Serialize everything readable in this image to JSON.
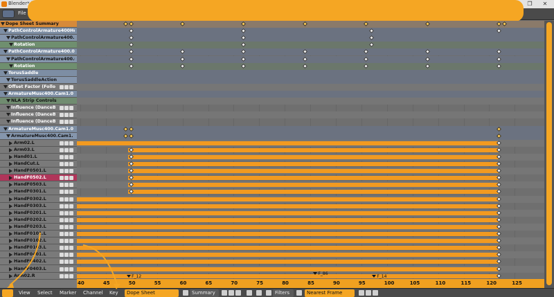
{
  "window": {
    "title": "Blender* [",
    "file_menu": "File"
  },
  "channels": [
    {
      "label": "Dope Sheet Summary",
      "kind": "summary",
      "indent": 0
    },
    {
      "label": "PathControlArmature400He",
      "kind": "object",
      "indent": 4
    },
    {
      "label": "PathControlArmature400.",
      "kind": "object2",
      "indent": 8
    },
    {
      "label": "Rotation",
      "kind": "group",
      "indent": 12
    },
    {
      "label": "PathControlArmature400.0",
      "kind": "object",
      "indent": 4
    },
    {
      "label": "PathControlArmature400.0",
      "kind": "object2",
      "indent": 8
    },
    {
      "label": "Rotation",
      "kind": "group",
      "indent": 12
    },
    {
      "label": "TorusSaddle",
      "kind": "object",
      "indent": 4
    },
    {
      "label": "TorusSaddleAction",
      "kind": "object2",
      "indent": 8
    },
    {
      "label": "Offset Factor (Follow Pat",
      "kind": "fcurve",
      "indent": 4
    },
    {
      "label": "ArmatureMusc400.Cam1.0",
      "kind": "object",
      "indent": 4
    },
    {
      "label": "NLA Strip Controls",
      "kind": "nla",
      "indent": 8
    },
    {
      "label": "Influence (DanceB33",
      "kind": "fcurve",
      "indent": 8
    },
    {
      "label": "Influence (DanceB33",
      "kind": "fcurve",
      "indent": 8
    },
    {
      "label": "Influence (DanceB33",
      "kind": "fcurve",
      "indent": 8
    },
    {
      "label": "ArmatureMusc400.Cam1.0",
      "kind": "object",
      "indent": 4
    },
    {
      "label": "ArmatureMusc400.Cam1.",
      "kind": "object2",
      "indent": 8
    },
    {
      "label": "Arm02.L",
      "kind": "bone",
      "indent": 12
    },
    {
      "label": "Arm03.L",
      "kind": "bone",
      "indent": 12
    },
    {
      "label": "Hand01.L",
      "kind": "bone",
      "indent": 12
    },
    {
      "label": "HandCut.L",
      "kind": "bone",
      "indent": 12
    },
    {
      "label": "HandF0501.L",
      "kind": "bone",
      "indent": 12
    },
    {
      "label": "HandF0502.L",
      "kind": "bone-active",
      "indent": 12
    },
    {
      "label": "HandF0503.L",
      "kind": "bone",
      "indent": 12
    },
    {
      "label": "HandF0301.L",
      "kind": "bone",
      "indent": 12
    },
    {
      "label": "HandF0302.L",
      "kind": "bone",
      "indent": 12
    },
    {
      "label": "HandF0303.L",
      "kind": "bone",
      "indent": 12
    },
    {
      "label": "HandF0201.L",
      "kind": "bone",
      "indent": 12
    },
    {
      "label": "HandF0202.L",
      "kind": "bone",
      "indent": 12
    },
    {
      "label": "HandF0203.L",
      "kind": "bone",
      "indent": 12
    },
    {
      "label": "HandF0101.L",
      "kind": "bone",
      "indent": 12
    },
    {
      "label": "HandF0102.L",
      "kind": "bone",
      "indent": 12
    },
    {
      "label": "HandF0103.L",
      "kind": "bone",
      "indent": 12
    },
    {
      "label": "HandF0401.L",
      "kind": "bone",
      "indent": 12
    },
    {
      "label": "HandF0402.L",
      "kind": "bone",
      "indent": 12
    },
    {
      "label": "HandF0403.L",
      "kind": "bone",
      "indent": 12
    },
    {
      "label": "Arm02.R",
      "kind": "bone",
      "indent": 12
    }
  ],
  "ruler": {
    "ticks": [
      "40",
      "45",
      "50",
      "55",
      "60",
      "65",
      "70",
      "75",
      "80",
      "85",
      "90",
      "95",
      "100",
      "105",
      "110",
      "115",
      "120",
      "125"
    ],
    "frame_start": 40,
    "frame_step": 5
  },
  "markers": [
    {
      "label": "F_12",
      "frame": 49.5
    },
    {
      "label": "F_14",
      "frame": 97.5
    },
    {
      "label": "F_86",
      "frame": 86
    }
  ],
  "footer": {
    "menus": [
      "View",
      "Select",
      "Marker",
      "Channel",
      "Key"
    ],
    "mode": "Dope Sheet",
    "summary": "Summary",
    "filters": "Filters",
    "snap": "Nearest Frame"
  },
  "colors": {
    "accent": "#f5a623",
    "hold": "#f29a20",
    "active_bone": "#b0355a"
  }
}
